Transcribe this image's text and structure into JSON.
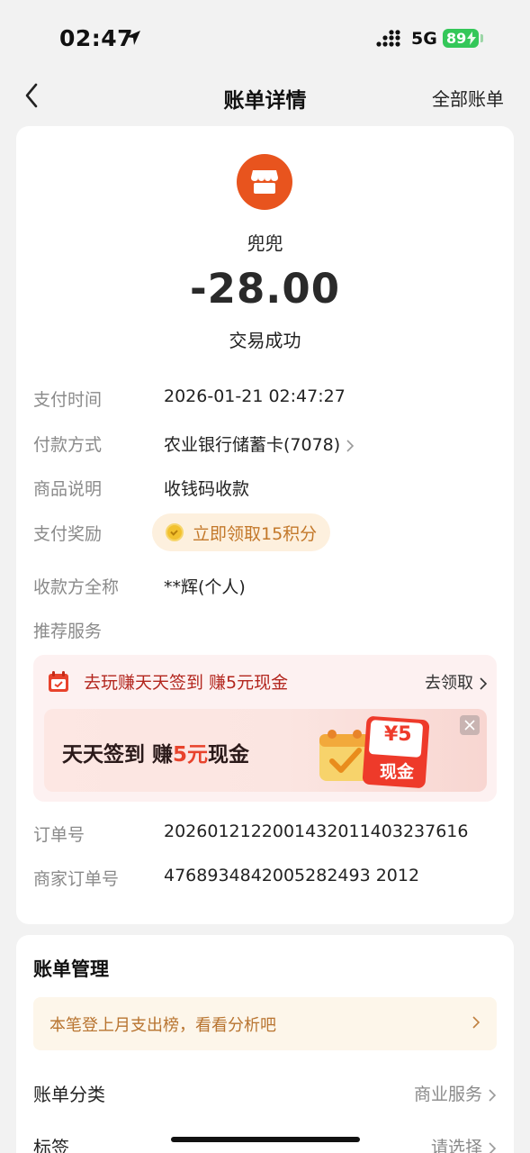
{
  "status_bar": {
    "time": "02:47",
    "network": "5G",
    "battery": "89"
  },
  "nav": {
    "title": "账单详情",
    "all_bills": "全部账单"
  },
  "transaction": {
    "merchant_name": "兜兜",
    "amount": "-28.00",
    "status": "交易成功",
    "details": [
      {
        "label": "支付时间",
        "value": "2026-01-21 02:47:27"
      },
      {
        "label": "付款方式",
        "value": "农业银行储蓄卡(7078)"
      },
      {
        "label": "商品说明",
        "value": "收钱码收款"
      },
      {
        "label": "支付奖励",
        "value": "立即领取15积分"
      },
      {
        "label": "收款方全称",
        "value": "**辉(个人)"
      },
      {
        "label": "推荐服务",
        "value": ""
      },
      {
        "label": "订单号",
        "value": "2026012122001432011403237616"
      },
      {
        "label": "商家订单号",
        "value": "4768934842005282493 2012"
      }
    ]
  },
  "promo": {
    "text": "去玩赚天天签到 赚5元现金",
    "action": "去领取",
    "banner_part1": "天天签到 赚",
    "banner_highlight": "5元",
    "banner_part2": "现金",
    "coupon_amount": "¥5",
    "coupon_label": "现金"
  },
  "management": {
    "title": "账单管理",
    "tip": "本笔登上月支出榜，看看分析吧",
    "rows": [
      {
        "label": "账单分类",
        "value": "商业服务"
      },
      {
        "label": "标签",
        "value": "请选择"
      }
    ]
  },
  "colors": {
    "accent": "#e8541e",
    "reward": "#c3782a",
    "promo_red": "#b3261e",
    "battery": "#34c759"
  }
}
